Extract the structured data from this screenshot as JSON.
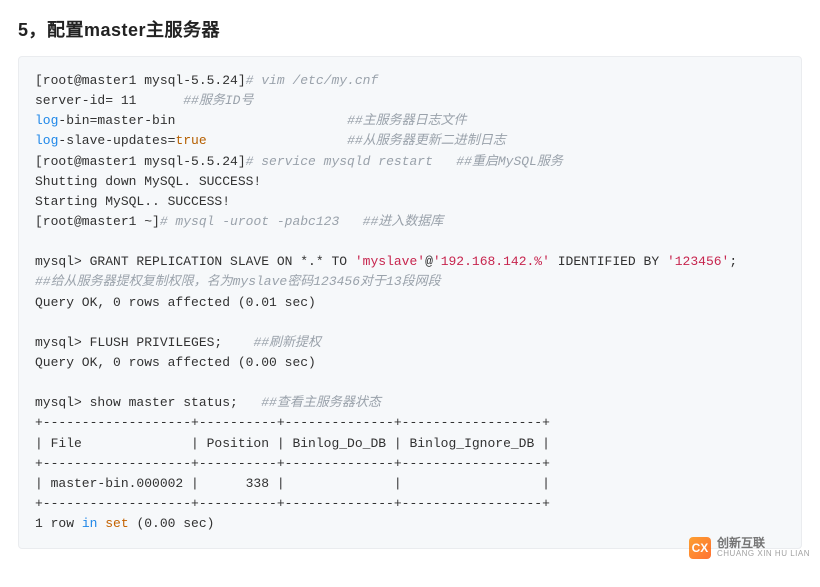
{
  "heading": "5，配置master主服务器",
  "code": {
    "l1_prompt": "[root@master1 mysql-5.5.24]",
    "l1_cmt": "# vim /etc/my.cnf",
    "l2_txt": "server-id= 11      ",
    "l2_cmt": "##服务ID号",
    "l3_kw": "log",
    "l3_txt": "-bin=master-bin                      ",
    "l3_cmt": "##主服务器日志文件",
    "l4_kw": "log",
    "l4_mid": "-slave-updates=",
    "l4_bool": "true",
    "l4_spc": "                  ",
    "l4_cmt": "##从服务器更新二进制日志",
    "l5_prompt": "[root@master1 mysql-5.5.24]",
    "l5_cmt": "# service mysqld restart   ##重启MySQL服务",
    "l6": "Shutting down MySQL. SUCCESS!",
    "l7": "Starting MySQL.. SUCCESS!",
    "l8_prompt": "[root@master1 ~]",
    "l8_cmt": "# mysql -uroot -pabc123   ##进入数据库",
    "l9_pre": "mysql> GRANT REPLICATION SLAVE ON *.* TO ",
    "l9_s1": "'myslave'",
    "l9_at": "@",
    "l9_s2": "'192.168.142.%'",
    "l9_mid": " IDENTIFIED BY ",
    "l9_s3": "'123456'",
    "l9_end": ";",
    "l10_cmt": "##给从服务器提权复制权限，名为myslave密码123456对于13段网段",
    "l11": "Query OK, 0 rows affected (0.01 sec)",
    "l12_pre": "mysql> FLUSH PRIVILEGES;    ",
    "l12_cmt": "##刷新提权",
    "l13": "Query OK, 0 rows affected (0.00 sec)",
    "l14_pre": "mysql> show master status;   ",
    "l14_cmt": "##查看主服务器状态",
    "tbl_border": "+-------------------+----------+--------------+------------------+",
    "tbl_header": "| File              | Position | Binlog_Do_DB | Binlog_Ignore_DB |",
    "tbl_row": "| master-bin.000002 |      338 |              |                  |",
    "l15_pre": "1 row ",
    "l15_kw": "in",
    "l15_mid": " ",
    "l15_kw2": "set",
    "l15_post": " (0.00 sec)"
  },
  "watermark": {
    "logo": "CX",
    "zh": "创新互联",
    "py": "CHUANG XIN HU LIAN"
  }
}
